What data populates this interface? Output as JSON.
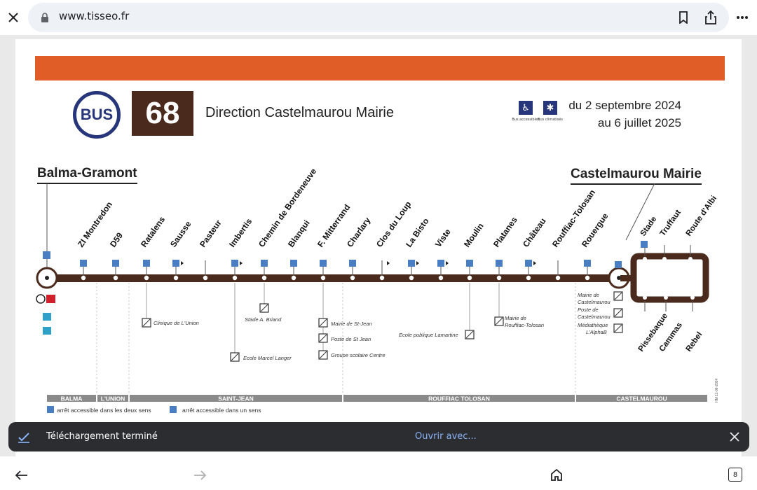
{
  "browser": {
    "url": "www.tisseo.fr",
    "close_icon": "close-icon",
    "lock_icon": "lock-icon",
    "tab_count": "8"
  },
  "header": {
    "mode_label": "BUS",
    "line_number": "68",
    "direction": "Direction Castelmaurou Mairie",
    "legend_accessible": "Bus accessibles",
    "legend_aircon": "Bus climatisés",
    "date_line1": "du 2 septembre 2024",
    "date_line2": "au 6 juillet 2025"
  },
  "termini": {
    "start": "Balma-Gramont",
    "end": "Castelmaurou Mairie"
  },
  "stops": [
    {
      "name": "ZI Montredon"
    },
    {
      "name": "D59"
    },
    {
      "name": "Ratalens"
    },
    {
      "name": "Sausse"
    },
    {
      "name": "Pasteur"
    },
    {
      "name": "Imbertis"
    },
    {
      "name": "Chemin de Bordeneuve"
    },
    {
      "name": "Blanqui"
    },
    {
      "name": "F. Mitterrand"
    },
    {
      "name": "Charlary"
    },
    {
      "name": "Clos du Loup"
    },
    {
      "name": "La Bisto"
    },
    {
      "name": "Viste"
    },
    {
      "name": "Moulin"
    },
    {
      "name": "Platanes"
    },
    {
      "name": "Château"
    },
    {
      "name": "Rouffiac-Tolosan"
    },
    {
      "name": "Rouergue"
    }
  ],
  "loop_top": [
    {
      "name": "Stade"
    },
    {
      "name": "Truffaut"
    },
    {
      "name": "Route d'Albi"
    }
  ],
  "loop_bottom": [
    {
      "name": "Pissebaque"
    },
    {
      "name": "Cammas"
    },
    {
      "name": "Rebel"
    }
  ],
  "pois": [
    {
      "label": "Clinique de L'Union"
    },
    {
      "label": "Stade A. Briand"
    },
    {
      "label": "Ecole Marcel Langer"
    },
    {
      "label": "Mairie de St-Jean"
    },
    {
      "label": "Poste de St Jean"
    },
    {
      "label": "Groupe scolaire Centre"
    },
    {
      "label": "Ecole publique Lamartine"
    },
    {
      "label": "Mairie de Rouffiac-Tolosan"
    },
    {
      "label": "Mairie de Castelmaurou"
    },
    {
      "label": "Poste de Castelmaurou"
    },
    {
      "label": "Médiathèque L'AlphaB"
    }
  ],
  "communes": [
    {
      "name": "BALMA"
    },
    {
      "name": "L'UNION"
    },
    {
      "name": "SAINT-JEAN"
    },
    {
      "name": "ROUFFIAC TOLOSAN"
    },
    {
      "name": "CASTELMAUROU"
    }
  ],
  "legend": {
    "both": "arrêt accessible dans les deux sens",
    "one": "arrêt accessible dans un sens"
  },
  "side_code": "HM 11-06-2024",
  "toast": {
    "message": "Téléchargement terminé",
    "action": "Ouvrir avec..."
  },
  "colors": {
    "route": "#4a2a1c",
    "banner": "#e05d27",
    "bus_blue": "#27357a",
    "toast_bg": "#2b2d31",
    "toast_link": "#8ab4f8"
  }
}
